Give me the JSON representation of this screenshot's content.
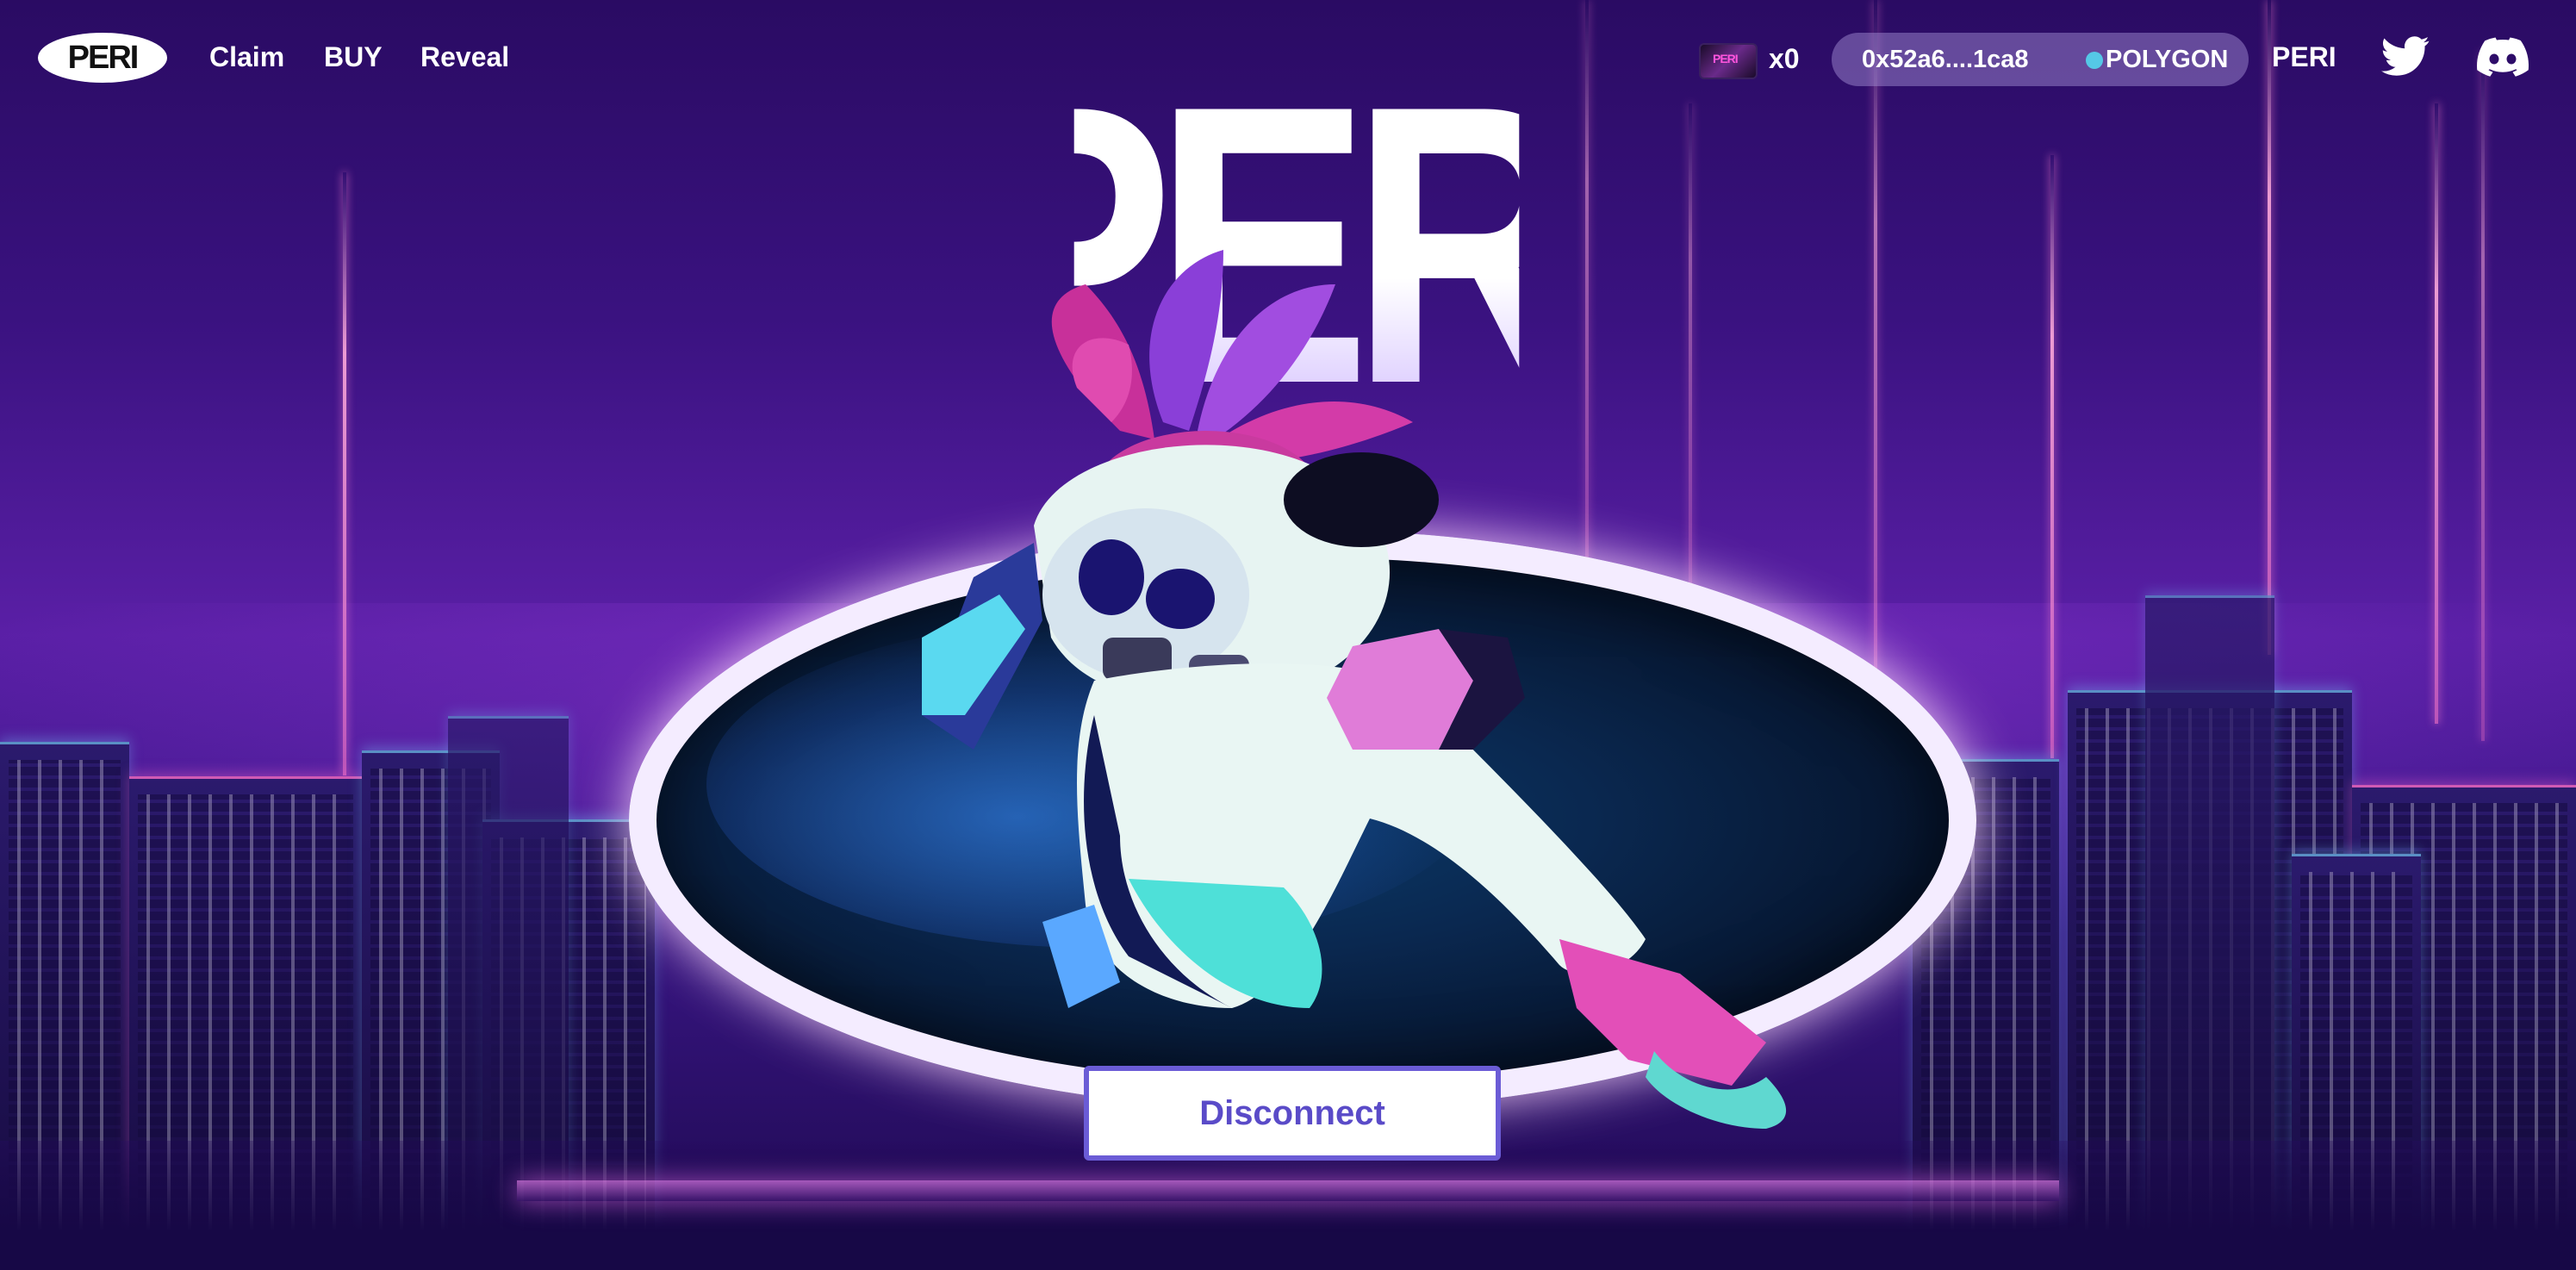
{
  "header": {
    "logo_text": "PERI",
    "nav": [
      {
        "label": "Claim"
      },
      {
        "label": "BUY"
      },
      {
        "label": "Reveal"
      }
    ],
    "nft_thumb_text": "PERI",
    "nft_count": "x0",
    "wallet": {
      "address": "0x52a6....1ca8",
      "network": "POLYGON",
      "network_color": "#55c8e6"
    },
    "token_label": "PERI",
    "social": [
      {
        "icon": "twitter-icon"
      },
      {
        "icon": "discord-icon"
      }
    ]
  },
  "hero": {
    "title": "PERI",
    "disconnect_label": "Disconnect"
  },
  "colors": {
    "accent": "#6b5cd6",
    "button_text": "#5a4bc8",
    "background": "#3a1280"
  }
}
